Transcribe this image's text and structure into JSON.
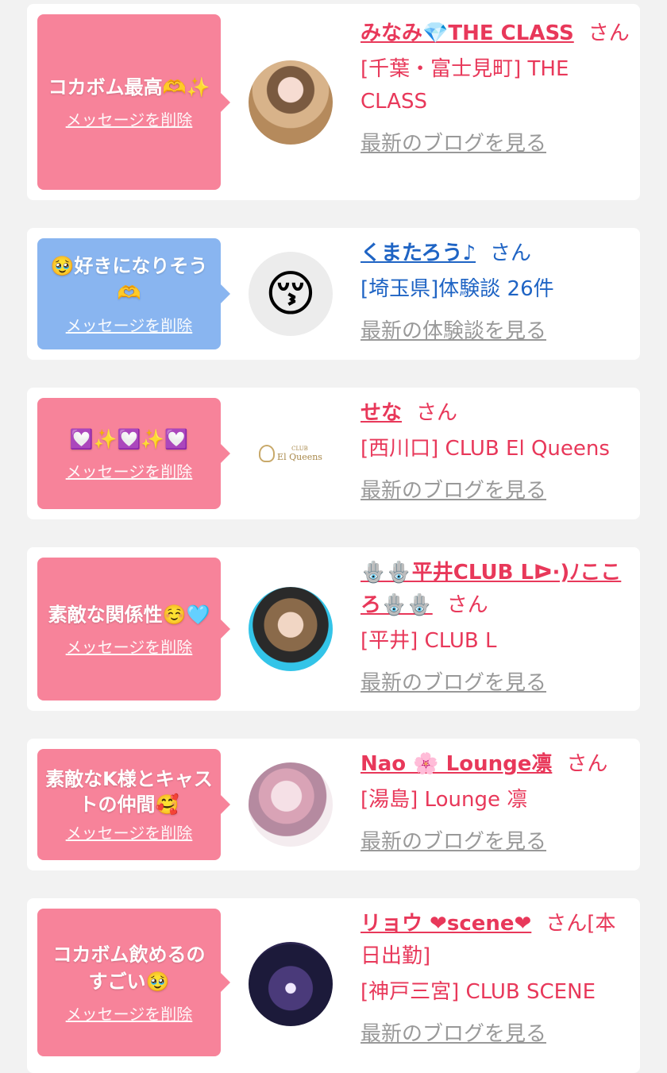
{
  "common": {
    "delete_label": "メッセージを削除",
    "san": "さん"
  },
  "cards": [
    {
      "message": "コカボム最高🫶✨",
      "name": "みなみ💎THE CLASS",
      "san": "さん",
      "detail": "[千葉・富士見町] THE CLASS",
      "link": "最新のブログを見る"
    },
    {
      "message": "🥹好きになりそう🫶",
      "name": "くまたろう♪",
      "san": "さん",
      "detail": "[埼玉県]体験談 26件",
      "link": "最新の体験談を見る",
      "avatar_emoji": "😚"
    },
    {
      "message": "💟✨💟✨💟",
      "name": "せな",
      "san": "さん",
      "detail": "[西川口] CLUB El Queens",
      "link": "最新のブログを見る",
      "logo_small": "CLUB",
      "logo_text": "El Queens"
    },
    {
      "message": "素敵な関係性☺️🩵",
      "name": "🪬🪬平井CLUB Lᐅ·)ﾉこころ🪬🪬",
      "san": "さん",
      "detail": "[平井] CLUB L",
      "link": "最新のブログを見る"
    },
    {
      "message": "素敵なK様とキャストの仲間🥰",
      "name": "Nao 🌸 Lounge凛",
      "san": "さん",
      "detail": "[湯島] Lounge 凛",
      "link": "最新のブログを見る"
    },
    {
      "message": "コカボム飲めるのすごい🥹",
      "name": "リョウ ❤scene❤",
      "san": "さん[本日出勤]",
      "detail": "[神戸三宮] CLUB SCENE",
      "link": "最新のブログを見る"
    }
  ]
}
